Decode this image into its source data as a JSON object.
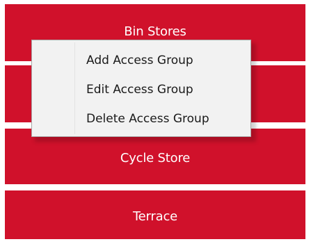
{
  "tiles": [
    {
      "label": "Bin Stores"
    },
    {
      "label": ""
    },
    {
      "label": "Cycle Store"
    },
    {
      "label": "Terrace"
    }
  ],
  "context_menu": {
    "items": [
      {
        "label": "Add Access Group"
      },
      {
        "label": "Edit Access Group"
      },
      {
        "label": "Delete Access Group"
      }
    ]
  },
  "colors": {
    "tile_background": "#d0112b",
    "tile_text": "#ffffff",
    "menu_background": "#f2f2f2",
    "menu_border": "#a9a9a9",
    "menu_text": "#1a1a1a"
  }
}
